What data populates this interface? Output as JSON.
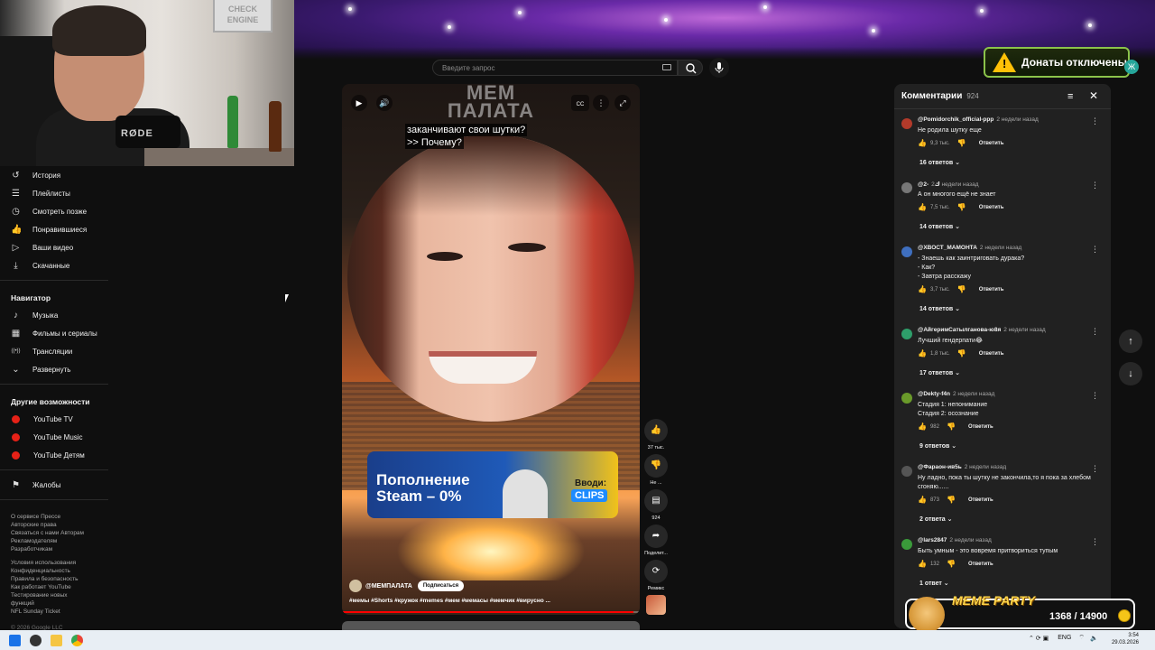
{
  "webcam": {
    "sign_text": "CHECK ENGINE",
    "mic_brand": "RØDE"
  },
  "search": {
    "placeholder": "Введите запрос"
  },
  "donations": {
    "text": "Донаты отключены",
    "badge": "Ж",
    "warning_glyph": "!"
  },
  "sidebar": {
    "library": [
      {
        "label": "История",
        "icon": "history-icon",
        "glyph": "↺"
      },
      {
        "label": "Плейлисты",
        "icon": "playlist-icon",
        "glyph": "☰"
      },
      {
        "label": "Смотреть позже",
        "icon": "clock-icon",
        "glyph": "◷"
      },
      {
        "label": "Понравившиеся",
        "icon": "thumb-up-icon",
        "glyph": "👍"
      },
      {
        "label": "Ваши видео",
        "icon": "video-icon",
        "glyph": "▷"
      },
      {
        "label": "Скачанные",
        "icon": "download-icon",
        "glyph": "⤓"
      }
    ],
    "navigator_title": "Навигатор",
    "navigator": [
      {
        "label": "Музыка",
        "icon": "music-icon",
        "glyph": "♪"
      },
      {
        "label": "Фильмы и сериалы",
        "icon": "film-icon",
        "glyph": "▦"
      },
      {
        "label": "Трансляции",
        "icon": "live-icon",
        "glyph": "((•))"
      },
      {
        "label": "Развернуть",
        "icon": "chevron-down-icon",
        "glyph": "⌄"
      }
    ],
    "other_title": "Другие возможности",
    "other": [
      {
        "label": "YouTube TV"
      },
      {
        "label": "YouTube Music"
      },
      {
        "label": "YouTube Детям"
      }
    ],
    "report": {
      "label": "Жалобы",
      "glyph": "⚑"
    },
    "footer1": [
      "О сервисе  Прессе",
      "Авторские права",
      "Связаться с нами  Авторам",
      "Рекламодателям",
      "Разработчикам"
    ],
    "footer2": [
      "Условия использования",
      "Конфиденциальность",
      "Правила и безопасность",
      "Как работает YouTube",
      "Тестирование новых",
      "функций",
      "NFL Sunday Ticket"
    ],
    "copyright": "© 2026 Google LLC"
  },
  "player": {
    "watermark": "МЕМ ПАЛАТА",
    "subtitle_line1": "заканчивают свои шутки?",
    "subtitle_line2": ">> Почему?",
    "ad_line1": "Пополнение",
    "ad_line2": "Steam – 0%",
    "ad_enter": "Вводи:",
    "ad_code": "CLIPS",
    "channel": "@МЕМПАЛАТА",
    "subscribe": "Подписаться",
    "hashtags": "#мемы #Shorts #кружок #memes #мем #мемасы #мемчик #вирусно ...",
    "progress": 0.98
  },
  "rail": {
    "likes": "37 тыс.",
    "dislike": "Не ...",
    "comments": "924",
    "share": "Поделит...",
    "remix": "Ремикс"
  },
  "comments": {
    "title": "Комментарии",
    "count": "924",
    "items": [
      {
        "author": "@Pomidorchik_official-ppp",
        "time": "2 недели назад",
        "lines": [
          "Не родила шутку еще"
        ],
        "likes": "9,3 тыс.",
        "replies": "16 ответов",
        "color": "#b23a2a"
      },
      {
        "author": "@2-ك",
        "time": "2 недели назад",
        "lines": [
          "А он многого ещё не знает"
        ],
        "likes": "7,5 тыс.",
        "replies": "14 ответов",
        "color": "#777"
      },
      {
        "author": "@XВОСТ_МАМОНТА",
        "time": "2 недели назад",
        "lines": [
          "- Знаешь как заинтриговать дурака?",
          "- Как?",
          "- Завтра расскажу"
        ],
        "likes": "3,7 тыс.",
        "replies": "14 ответов",
        "color": "#3f6fbf"
      },
      {
        "author": "@АйгеримСатылганова-ю8я",
        "time": "2 недели назад",
        "lines": [
          "Лучший гендерпати😂"
        ],
        "likes": "1,8 тыс.",
        "replies": "17 ответов",
        "color": "#2e9e6a"
      },
      {
        "author": "@Dekty-f4n",
        "time": "2 недели назад",
        "lines": [
          "Стадия 1: непонимание",
          "Стадия 2: осознание"
        ],
        "likes": "982",
        "replies": "9 ответов",
        "color": "#6a9a2a"
      },
      {
        "author": "@Фараон-ив5ь",
        "time": "2 недели назад",
        "lines": [
          "Ну ладно, пока ты шутку не закончила,то я пока за хлебом",
          "сгоняю......"
        ],
        "likes": "873",
        "replies": "2 ответа",
        "color": "#555"
      },
      {
        "author": "@lars2847",
        "time": "2 недели назад",
        "lines": [
          "Быть умным - это вовремя притвориться тупым"
        ],
        "likes": "132",
        "replies": "1 ответ",
        "color": "#3a9a3a"
      }
    ],
    "reply_label": "Ответить"
  },
  "overlay": {
    "title": "MEME PARTY",
    "score": "1368 / 14900"
  },
  "taskbar": {
    "lang": "ENG",
    "time": "3:54",
    "date": "29.03.2026"
  }
}
